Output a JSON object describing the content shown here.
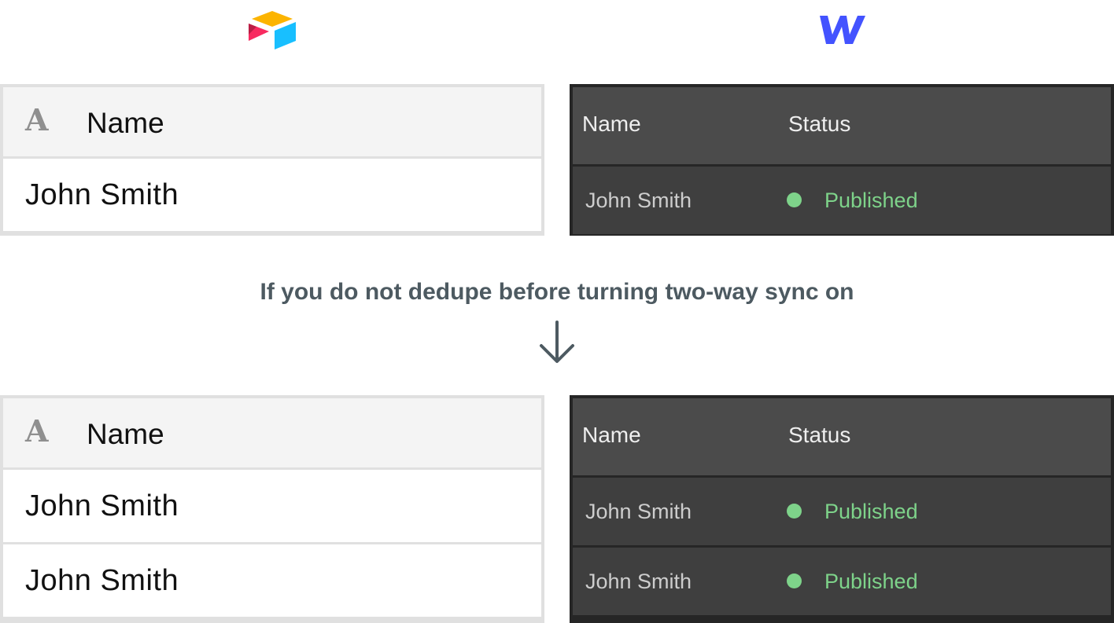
{
  "logos": {
    "left": "airtable-logo",
    "right": "webflow-logo"
  },
  "colors": {
    "published_green": "#7ed38a",
    "caption_color": "#4d5a61",
    "webflow_blue": "#4353ff"
  },
  "before": {
    "airtable": {
      "field_icon": "A",
      "header": "Name",
      "rows": [
        "John Smith"
      ]
    },
    "webflow": {
      "headers": {
        "name": "Name",
        "status": "Status"
      },
      "rows": [
        {
          "name": "John Smith",
          "status": "Published"
        }
      ]
    }
  },
  "caption": "If you do not dedupe before turning two-way sync on",
  "after": {
    "airtable": {
      "field_icon": "A",
      "header": "Name",
      "rows": [
        "John Smith",
        "John Smith"
      ]
    },
    "webflow": {
      "headers": {
        "name": "Name",
        "status": "Status"
      },
      "rows": [
        {
          "name": "John Smith",
          "status": "Published"
        },
        {
          "name": "John Smith",
          "status": "Published"
        }
      ]
    }
  }
}
